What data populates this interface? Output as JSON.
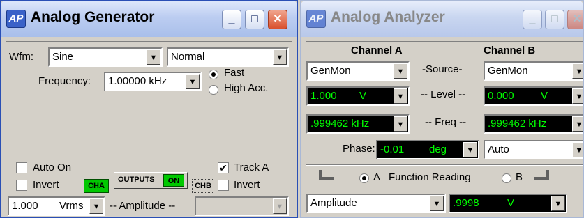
{
  "generator": {
    "logo": "AP",
    "title": "Analog Generator",
    "wfm_label": "Wfm:",
    "waveform": "Sine",
    "mode": "Normal",
    "frequency_label": "Frequency:",
    "frequency": "1.00000 kHz",
    "fast_label": "Fast",
    "high_acc_label": "High Acc.",
    "auto_on_label": "Auto On",
    "track_a_label": "Track A",
    "invert_label": "Invert",
    "invert_b_label": "Invert",
    "cha_label": "CHA",
    "outputs_label": "OUTPUTS",
    "on_label": "ON",
    "chb_label": "CHB",
    "amplitude_value": "1.000",
    "amplitude_unit": "Vrms",
    "amplitude_label": "-- Amplitude --"
  },
  "analyzer": {
    "logo": "AP",
    "title": "Analog Analyzer",
    "channel_a_label": "Channel A",
    "channel_b_label": "Channel B",
    "source_label": "-Source-",
    "source_a": "GenMon",
    "source_b": "GenMon",
    "level_label": "-- Level --",
    "level_a_value": "1.000",
    "level_a_unit": "V",
    "level_b_value": "0.000",
    "level_b_unit": "V",
    "freq_label": "-- Freq --",
    "freq_a": ".999462 kHz",
    "freq_b": ".999462 kHz",
    "phase_label": "Phase:",
    "phase_value": "-0.01",
    "phase_unit": "deg",
    "phase_mode": "Auto",
    "function_a_label": "A",
    "function_reading_label": "Function Reading",
    "function_b_label": "B",
    "function_type": "Amplitude",
    "function_value": ".9998",
    "function_unit": "V"
  },
  "icons": [
    "minimize-icon",
    "maximize-icon",
    "close-icon",
    "dropdown-arrow-icon"
  ],
  "colors": {
    "display_bg": "#000000",
    "display_text": "#00ff00",
    "close_button": "#d9502e"
  }
}
